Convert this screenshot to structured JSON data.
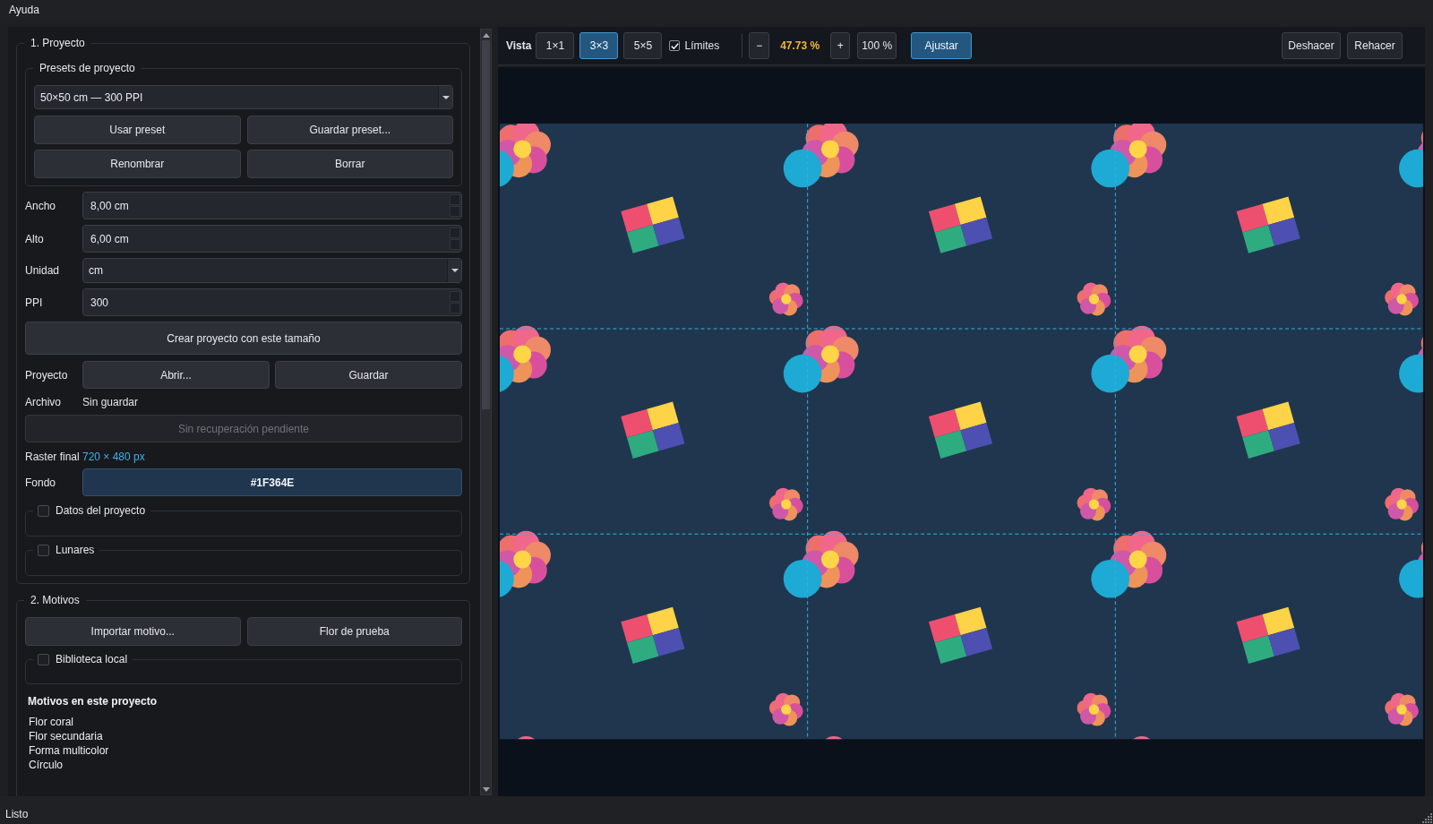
{
  "menu": [
    "Ayuda"
  ],
  "project": {
    "title": "1. Proyecto",
    "presets": {
      "title": "Presets de proyecto",
      "value": "50×50 cm — 300 PPI",
      "buttons": [
        "Usar preset",
        "Guardar preset...",
        "Renombrar",
        "Borrar"
      ]
    },
    "fields": [
      {
        "label": "Ancho",
        "kind": "spin",
        "value": "8,00 cm"
      },
      {
        "label": "Alto",
        "kind": "spin",
        "value": "6,00 cm"
      },
      {
        "label": "Unidad",
        "kind": "combo",
        "value": "cm"
      },
      {
        "label": "PPI",
        "kind": "spin",
        "value": "300"
      }
    ],
    "create_button": "Crear proyecto con este tamaño",
    "file_row": {
      "label": "Proyecto",
      "buttons": [
        "Abrir...",
        "Guardar"
      ]
    },
    "file_status": {
      "label": "Archivo",
      "value": "Sin guardar"
    },
    "recovery_button": {
      "label": "Sin recuperación pendiente",
      "disabled": true
    },
    "raster": {
      "label": "Raster final",
      "value": "720 × 480 px"
    },
    "background": {
      "label": "Fondo",
      "value": "#1F364E",
      "color": "#1f364e"
    },
    "sections": [
      {
        "title": "Datos del proyecto",
        "checked": false
      },
      {
        "title": "Lunares",
        "checked": false
      }
    ]
  },
  "motifs": {
    "title": "2. Motivos",
    "buttons": [
      "Importar motivo...",
      "Flor de prueba"
    ],
    "library": {
      "title": "Biblioteca local",
      "checked": false
    },
    "list_title": "Motivos en este proyecto",
    "items": [
      "Flor coral",
      "Flor secundaria",
      "Forma multicolor",
      "Círculo"
    ]
  },
  "toolbar": {
    "label": "Vista",
    "views": [
      {
        "label": "1×1",
        "selected": false
      },
      {
        "label": "3×3",
        "selected": true
      },
      {
        "label": "5×5",
        "selected": false
      }
    ],
    "limits": {
      "label": "Límites",
      "checked": true
    },
    "zoom_out": "−",
    "zoom": "47.73 %",
    "zoom_in": "+",
    "actual_size": "100 %",
    "fit": {
      "label": "Ajustar",
      "on": true
    },
    "history": [
      "Deshacer",
      "Rehacer"
    ]
  },
  "status_bar": "Listo"
}
